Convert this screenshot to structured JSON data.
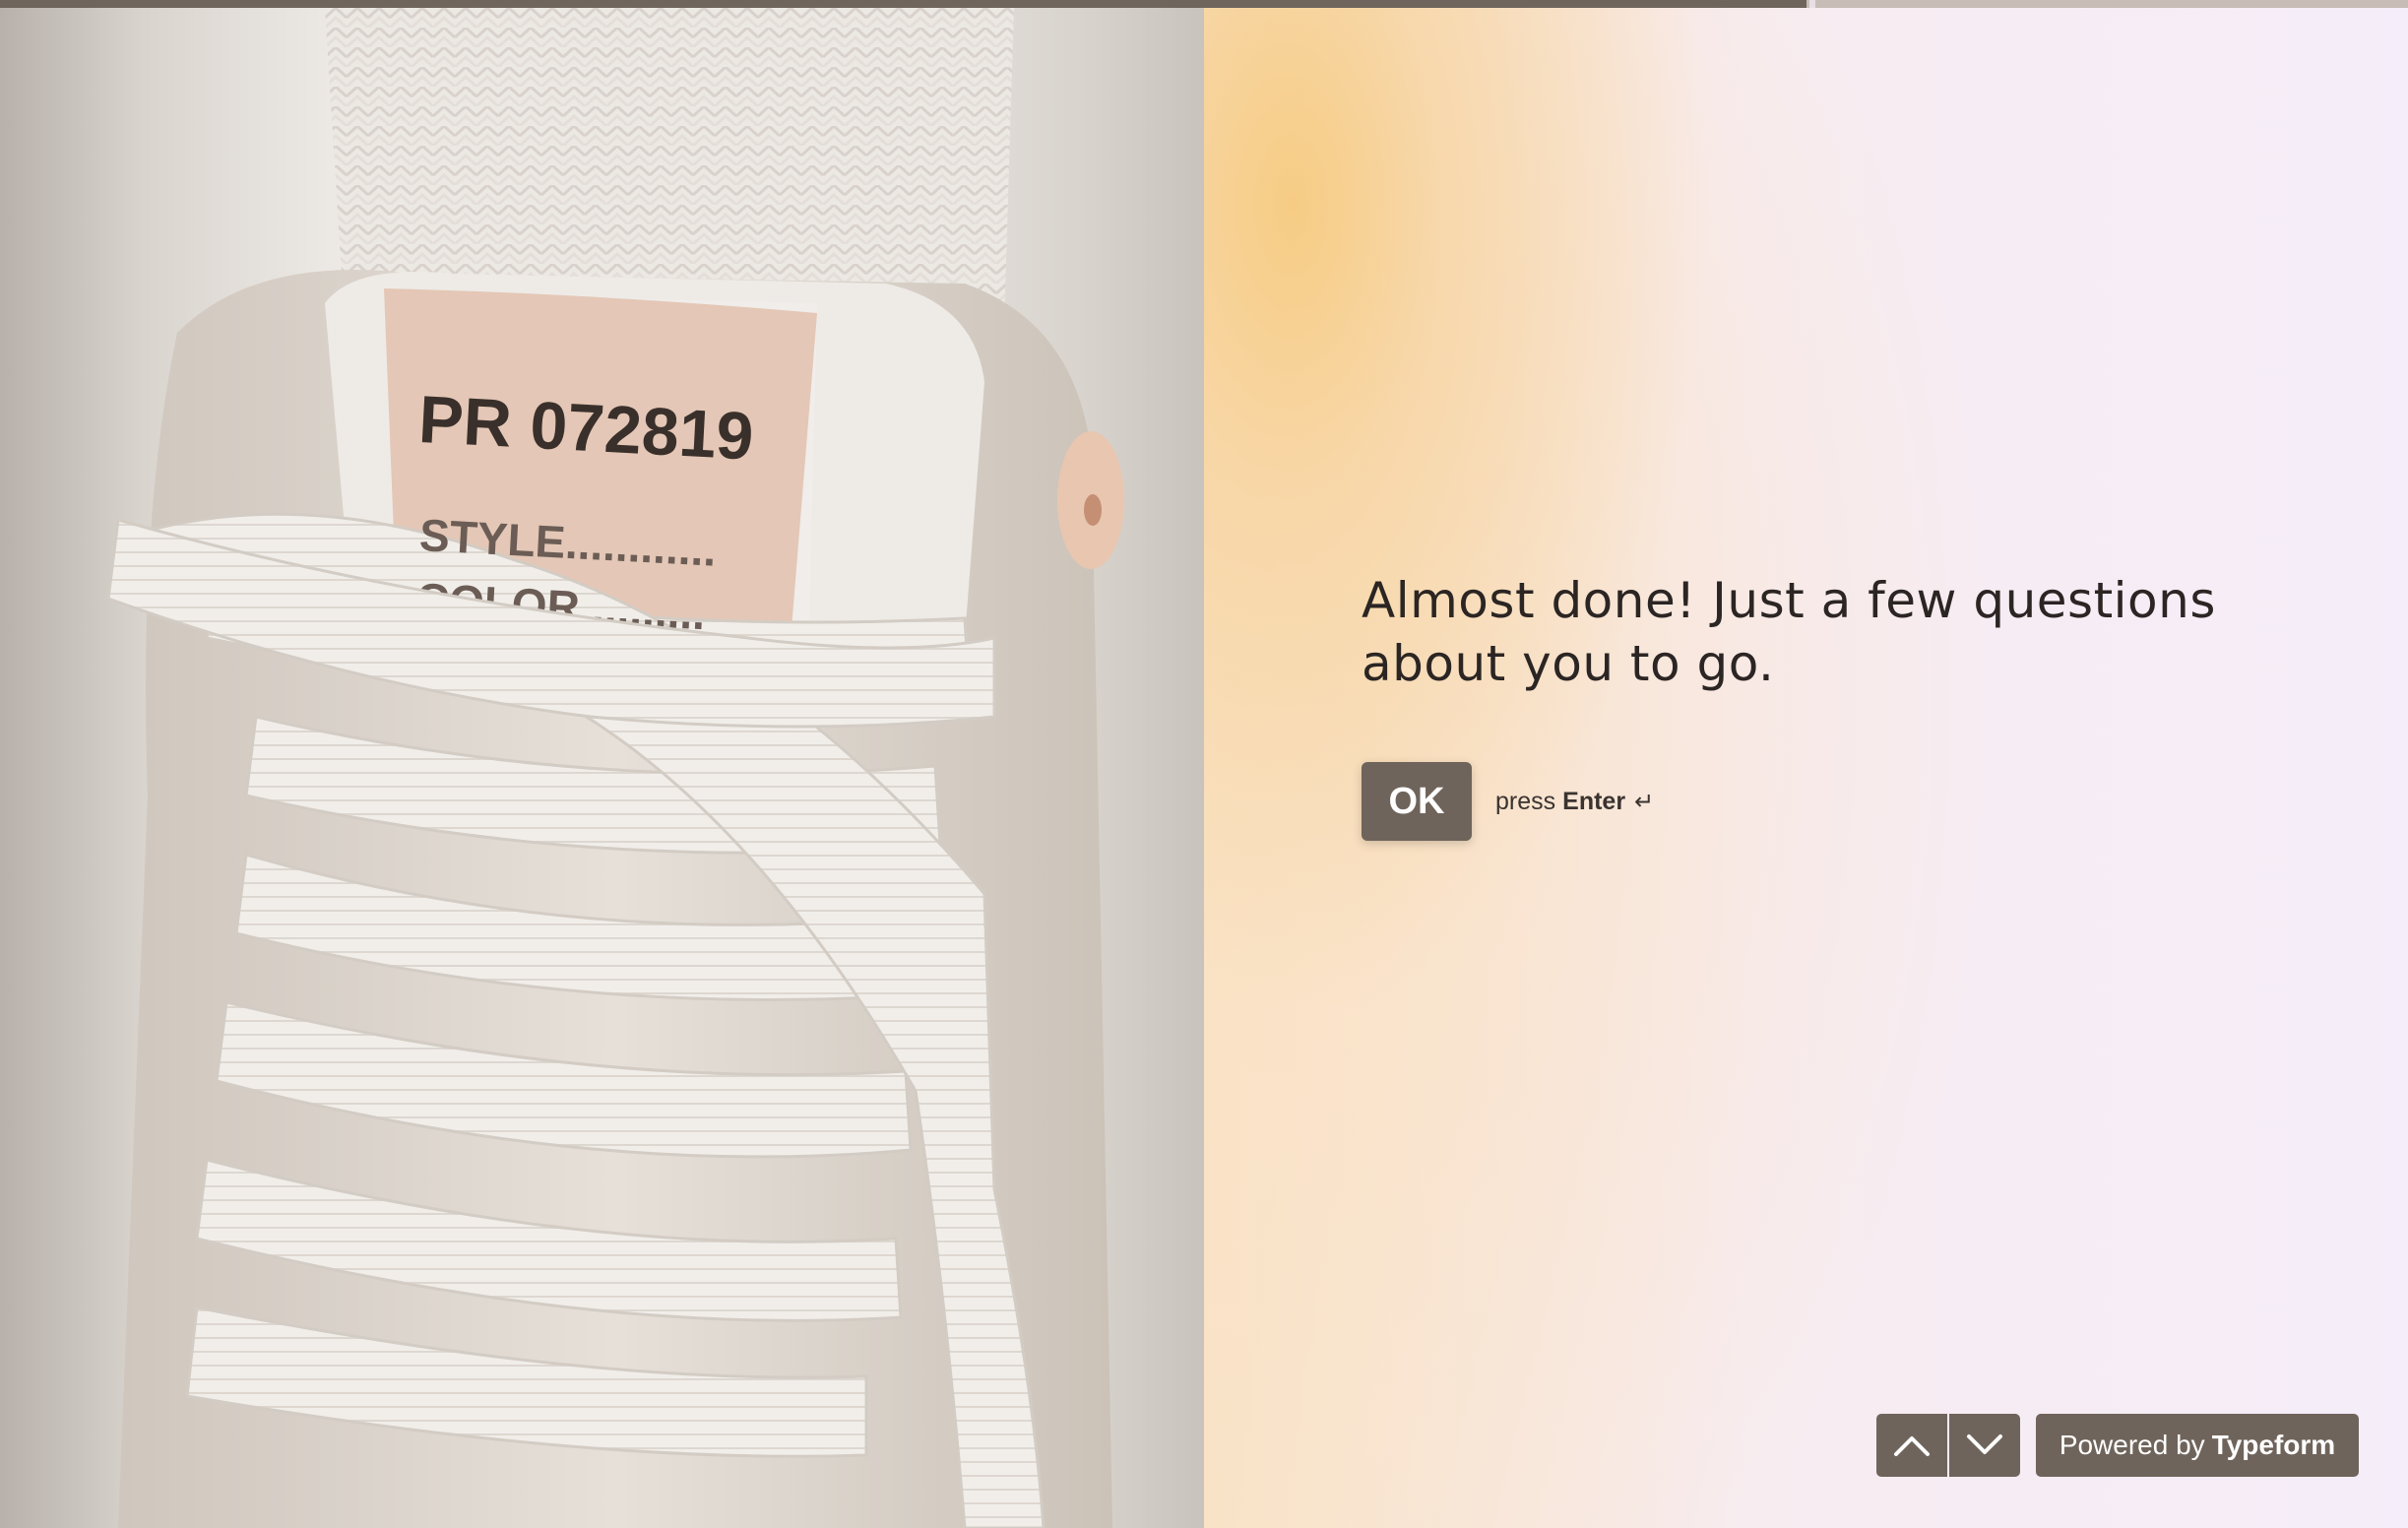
{
  "progress": {
    "fraction": 0.75
  },
  "photo": {
    "tag_number": "PR 072819",
    "tag_line1": "STYLE............",
    "tag_line2": "COLOR.........."
  },
  "question": {
    "line1": "Almost done! Just a few questions",
    "line2": "about you to go."
  },
  "ok": {
    "label": "OK",
    "hint_prefix": "press",
    "hint_key": "Enter",
    "hint_icon": "↵"
  },
  "nav": {
    "up_icon": "chevron-up-icon",
    "down_icon": "chevron-down-icon"
  },
  "powered": {
    "prefix": "Powered by",
    "brand": "Typeform"
  },
  "colors": {
    "accent": "#6f645b",
    "text": "#2b2523",
    "background": "#f5edf9"
  }
}
